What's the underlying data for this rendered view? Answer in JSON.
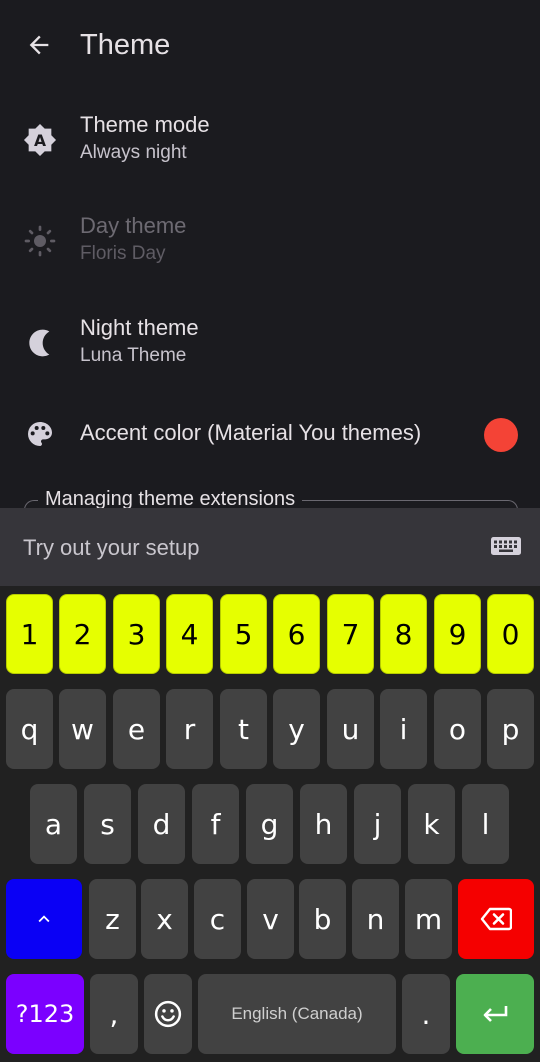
{
  "header": {
    "title": "Theme"
  },
  "prefs": {
    "theme_mode": {
      "title": "Theme mode",
      "summary": "Always night",
      "icon": "auto-theme-icon"
    },
    "day_theme": {
      "title": "Day theme",
      "summary": "Floris Day",
      "icon": "sun-icon",
      "enabled": false
    },
    "night_theme": {
      "title": "Night theme",
      "summary": "Luna Theme",
      "icon": "moon-icon"
    },
    "accent": {
      "title": "Accent color (Material You themes)",
      "icon": "palette-icon",
      "color": "#f44336"
    }
  },
  "group": {
    "label": "Managing theme extensions"
  },
  "tryout": {
    "placeholder": "Try out your setup",
    "icon": "keyboard-icon"
  },
  "keyboard": {
    "numbers": [
      "1",
      "2",
      "3",
      "4",
      "5",
      "6",
      "7",
      "8",
      "9",
      "0"
    ],
    "row1": [
      "q",
      "w",
      "e",
      "r",
      "t",
      "y",
      "u",
      "i",
      "o",
      "p"
    ],
    "row2": [
      "a",
      "s",
      "d",
      "f",
      "g",
      "h",
      "j",
      "k",
      "l"
    ],
    "row3": [
      "z",
      "x",
      "c",
      "v",
      "b",
      "n",
      "m"
    ],
    "symbols_label": "?123",
    "comma": ",",
    "space_label": "English (Canada)",
    "period": ".",
    "colors": {
      "numbers": "#e6ff00",
      "shift": "#0a00f5",
      "delete": "#f50000",
      "symbols": "#7b00ff",
      "enter": "#4caf50",
      "keys": "#424242"
    }
  }
}
